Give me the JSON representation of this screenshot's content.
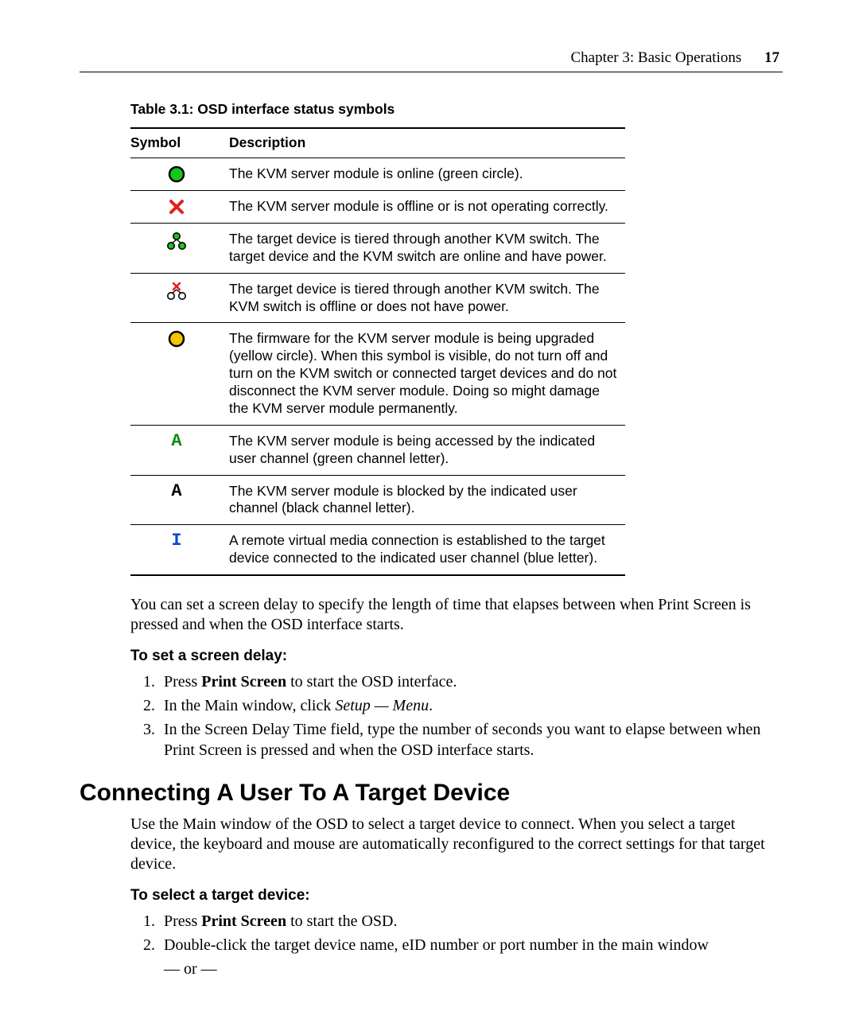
{
  "header": {
    "chapter": "Chapter 3: Basic Operations",
    "page_number": "17"
  },
  "table": {
    "caption": "Table 3.1: OSD interface status symbols",
    "head_symbol": "Symbol",
    "head_desc": "Description",
    "rows": [
      {
        "icon": "online-circle-icon",
        "desc": "The KVM server module is online (green circle)."
      },
      {
        "icon": "offline-x-icon",
        "desc": "The KVM server module is offline or is not operating correctly."
      },
      {
        "icon": "tier-online-icon",
        "desc": "The target device is tiered through another KVM switch. The target device and the KVM switch are online and have power."
      },
      {
        "icon": "tier-offline-icon",
        "desc": "The target device is tiered through another KVM switch. The KVM switch is offline or does not have power."
      },
      {
        "icon": "upgrade-circle-icon",
        "desc": "The firmware for the KVM server module is being upgraded (yellow circle). When this symbol is visible, do not turn off and turn on the KVM switch or connected target devices and do not disconnect the KVM server module. Doing so might damage the KVM server module permanently."
      },
      {
        "icon": "green-a-icon",
        "letter": "A",
        "desc": "The KVM server module is being accessed by the indicated user channel (green channel letter)."
      },
      {
        "icon": "black-a-icon",
        "letter": "A",
        "desc": "The KVM server module is blocked by the indicated user channel (black channel letter)."
      },
      {
        "icon": "blue-i-icon",
        "letter": "I",
        "desc": "A remote virtual media connection is established to the target device connected to the indicated user channel (blue letter)."
      }
    ]
  },
  "para_after_table": "You can set a screen delay to specify the length of time that elapses between when Print Screen is pressed and when the OSD interface starts.",
  "proc1": {
    "title": "To set a screen delay:",
    "step1_pre": "Press ",
    "step1_bold": "Print Screen",
    "step1_post": " to start the OSD interface.",
    "step2_pre": "In the Main window, click ",
    "step2_ital": "Setup — Menu",
    "step2_post": ".",
    "step3": "In the Screen Delay Time field, type the number of seconds you want to elapse between when Print Screen is pressed and when the OSD interface starts."
  },
  "section_heading": "Connecting A User To A Target Device",
  "para_section": "Use the Main window of the OSD to select a target device to connect. When you select a target device, the keyboard and mouse are automatically reconfigured to the correct settings for that target device.",
  "proc2": {
    "title": "To select a target device:",
    "step1_pre": "Press ",
    "step1_bold": "Print Screen",
    "step1_post": " to start the OSD.",
    "step2": "Double-click the target device name, eID number or port number in the main window",
    "or": "— or —"
  }
}
